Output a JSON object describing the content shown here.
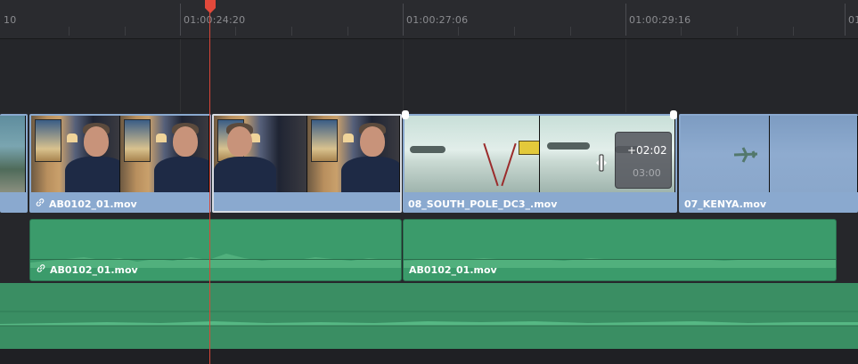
{
  "ruler": {
    "timecodes": [
      "10",
      "01:00:24:20",
      "01:00:27:06",
      "01:00:29:16",
      "01"
    ]
  },
  "video_track": {
    "clips": [
      {
        "name": "",
        "thumbnail": "aerial-landscape"
      },
      {
        "name": "AB0102_01.mov",
        "linked": true,
        "thumbnail": "interview"
      },
      {
        "name": "",
        "thumbnail": "interview",
        "selected": true
      },
      {
        "name": "08_SOUTH_POLE_DC3_.mov",
        "thumbnail": "snow-airfield"
      },
      {
        "name": "07_KENYA.mov",
        "thumbnail": "sky-plane"
      }
    ]
  },
  "audio_track_1": {
    "clips": [
      {
        "name": "AB0102_01.mov",
        "linked": true
      },
      {
        "name": "AB0102_01.mov",
        "linked": false
      }
    ]
  },
  "trim_overlay": {
    "delta": "+02:02",
    "duration": "03:00"
  },
  "colors": {
    "video_clip": "#8aa9cf",
    "audio_clip": "#3b9b6b",
    "playhead": "#d84638",
    "ruler_bg": "#2a2b2f"
  },
  "icons": {
    "link": "link-icon",
    "playhead": "playhead-marker-icon",
    "trim_cursor": "trim-cursor-icon"
  }
}
